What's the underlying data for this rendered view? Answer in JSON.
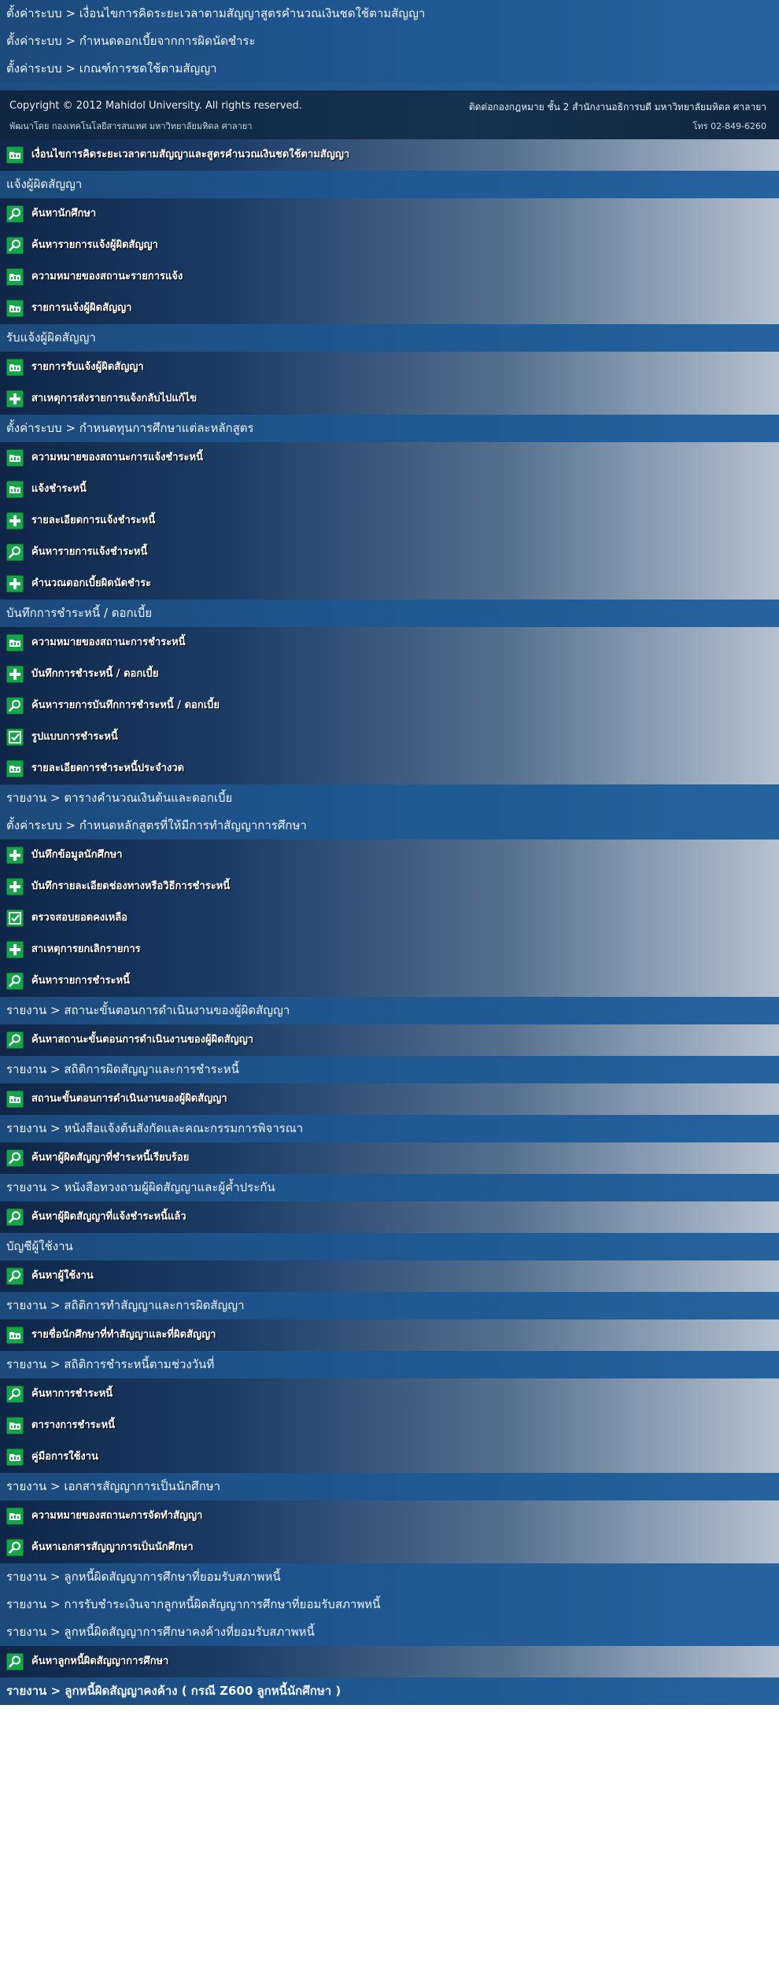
{
  "top_links": [
    "ตั้งค่าระบบ > เงื่อนไขการคิดระยะเวลาตามสัญญาสูตรคำนวณเงินชดใช้ตามสัญญา",
    "ตั้งค่าระบบ > กำหนดดอกเบี้ยจากการผิดนัดชำระ",
    "ตั้งค่าระบบ > เกณฑ์การชดใช้ตามสัญญา"
  ],
  "footer": {
    "copyright": "Copyright © 2012 Mahidol University. All rights reserved.",
    "developer": "พัฒนาโดย กองเทคโนโลยีสารสนเทศ มหาวิทยาลัยมหิดล ศาลายา",
    "contact": "ติดต่อกองกฎหมาย ชั้น 2 สำนักงานอธิการบดี มหาวิทยาลัยมหิดล ศาลายา",
    "phone": "โทร 02-849-6260"
  },
  "colors": {
    "header": "#1f5690",
    "icon_green": "#16a34a"
  },
  "menu": [
    {
      "type": "item",
      "icon": "folder-icon",
      "label": "เงื่อนไขการคิดระยะเวลาตามสัญญาและสูตรคำนวณเงินชดใช้ตามสัญญา"
    },
    {
      "type": "header",
      "label": "แจ้งผู้ผิดสัญญา"
    },
    {
      "type": "item",
      "icon": "search-icon",
      "label": "ค้นหานักศึกษา"
    },
    {
      "type": "item",
      "icon": "search-icon",
      "label": "ค้นหารายการแจ้งผู้ผิดสัญญา"
    },
    {
      "type": "item",
      "icon": "folder-icon",
      "label": "ความหมายของสถานะรายการแจ้ง"
    },
    {
      "type": "item",
      "icon": "folder-icon",
      "label": "รายการแจ้งผู้ผิดสัญญา"
    },
    {
      "type": "header",
      "label": "รับแจ้งผู้ผิดสัญญา"
    },
    {
      "type": "item",
      "icon": "folder-icon",
      "label": "รายการรับแจ้งผู้ผิดสัญญา"
    },
    {
      "type": "item",
      "icon": "plus-icon",
      "label": "สาเหตุการส่งรายการแจ้งกลับไปแก้ไข"
    },
    {
      "type": "header",
      "label": "ตั้งค่าระบบ > กำหนดทุนการศึกษาแต่ละหลักสูตร"
    },
    {
      "type": "item",
      "icon": "folder-icon",
      "label": "ความหมายของสถานะการแจ้งชำระหนี้"
    },
    {
      "type": "item",
      "icon": "folder-icon",
      "label": "แจ้งชำระหนี้"
    },
    {
      "type": "item",
      "icon": "plus-icon",
      "label": "รายละเอียดการแจ้งชำระหนี้"
    },
    {
      "type": "item",
      "icon": "search-icon",
      "label": "ค้นหารายการแจ้งชำระหนี้"
    },
    {
      "type": "item",
      "icon": "plus-icon",
      "label": "คำนวณดอกเบี้ยผิดนัดชำระ"
    },
    {
      "type": "header",
      "label": "บันทึกการชำระหนี้ / ดอกเบี้ย"
    },
    {
      "type": "item",
      "icon": "folder-icon",
      "label": "ความหมายของสถานะการชำระหนี้"
    },
    {
      "type": "item",
      "icon": "plus-icon",
      "label": "บันทึกการชำระหนี้ / ดอกเบี้ย"
    },
    {
      "type": "item",
      "icon": "search-icon",
      "label": "ค้นหารายการบันทึกการชำระหนี้ / ดอกเบี้ย"
    },
    {
      "type": "item",
      "icon": "check-icon",
      "label": "รูปแบบการชำระหนี้"
    },
    {
      "type": "item",
      "icon": "folder-icon",
      "label": "รายละเอียดการชำระหนี้ประจำงวด"
    },
    {
      "type": "header",
      "label": "รายงาน > ตารางคำนวณเงินต้นและดอกเบี้ย"
    },
    {
      "type": "header",
      "label": "ตั้งค่าระบบ > กำหนดหลักสูตรที่ให้มีการทำสัญญาการศึกษา"
    },
    {
      "type": "item",
      "icon": "plus-icon",
      "label": "บันทึกข้อมูลนักศึกษา"
    },
    {
      "type": "item",
      "icon": "plus-icon",
      "label": "บันทึกรายละเอียดช่องทางหรือวิธีการชำระหนี้"
    },
    {
      "type": "item",
      "icon": "check-icon",
      "label": "ตรวจสอบยอดคงเหลือ"
    },
    {
      "type": "item",
      "icon": "plus-icon",
      "label": "สาเหตุการยกเลิกรายการ"
    },
    {
      "type": "item",
      "icon": "search-icon",
      "label": "ค้นหารายการชำระหนี้"
    },
    {
      "type": "header",
      "label": "รายงาน > สถานะขั้นตอนการดำเนินงานของผู้ผิดสัญญา"
    },
    {
      "type": "item",
      "icon": "search-icon",
      "label": "ค้นหาสถานะขั้นตอนการดำเนินงานของผู้ผิดสัญญา"
    },
    {
      "type": "header",
      "label": "รายงาน > สถิติการผิดสัญญาและการชำระหนี้"
    },
    {
      "type": "item",
      "icon": "folder-icon",
      "label": "สถานะขั้นตอนการดำเนินงานของผู้ผิดสัญญา"
    },
    {
      "type": "header",
      "label": "รายงาน > หนังสือแจ้งต้นสังกัดและคณะกรรมการพิจารณา"
    },
    {
      "type": "item",
      "icon": "search-icon",
      "label": "ค้นหาผู้ผิดสัญญาที่ชำระหนี้เรียบร้อย"
    },
    {
      "type": "header",
      "label": "รายงาน > หนังสือทวงถามผู้ผิดสัญญาและผู้ค้ำประกัน"
    },
    {
      "type": "item",
      "icon": "search-icon",
      "label": "ค้นหาผู้ผิดสัญญาที่แจ้งชำระหนี้แล้ว"
    },
    {
      "type": "header",
      "label": "บัญชีผู้ใช้งาน"
    },
    {
      "type": "item",
      "icon": "search-icon",
      "label": "ค้นหาผู้ใช้งาน"
    },
    {
      "type": "header",
      "label": "รายงาน > สถิติการทำสัญญาและการผิดสัญญา"
    },
    {
      "type": "item",
      "icon": "folder-icon",
      "label": "รายชื่อนักศึกษาที่ทำสัญญาและที่ผิดสัญญา"
    },
    {
      "type": "header",
      "label": "รายงาน > สถิติการชำระหนี้ตามช่วงวันที่"
    },
    {
      "type": "item",
      "icon": "search-icon",
      "label": "ค้นหาการชำระหนี้"
    },
    {
      "type": "item",
      "icon": "folder-icon",
      "label": "ตารางการชำระหนี้"
    },
    {
      "type": "item",
      "icon": "folder-icon",
      "label": "คู่มือการใช้งาน"
    },
    {
      "type": "header",
      "label": "รายงาน > เอกสารสัญญาการเป็นนักศึกษา"
    },
    {
      "type": "item",
      "icon": "folder-icon",
      "label": "ความหมายของสถานะการจัดทำสัญญา"
    },
    {
      "type": "item",
      "icon": "search-icon",
      "label": "ค้นหาเอกสารสัญญาการเป็นนักศึกษา"
    },
    {
      "type": "header",
      "label": "รายงาน > ลูกหนี้ผิดสัญญาการศึกษาที่ยอมรับสภาพหนี้"
    },
    {
      "type": "header",
      "label": "รายงาน > การรับชำระเงินจากลูกหนี้ผิดสัญญาการศึกษาที่ยอมรับสภาพหนี้"
    },
    {
      "type": "header",
      "label": "รายงาน > ลูกหนี้ผิดสัญญาการศึกษาคงค้างที่ยอมรับสภาพหนี้"
    },
    {
      "type": "item",
      "icon": "search-icon",
      "label": "ค้นหาลูกหนี้ผิดสัญญาการศึกษา"
    },
    {
      "type": "header",
      "label": "รายงาน > ลูกหนี้ผิดสัญญาคงค้าง ( กรณี Z600 ลูกหนี้นักศึกษา )",
      "bold": true
    }
  ]
}
